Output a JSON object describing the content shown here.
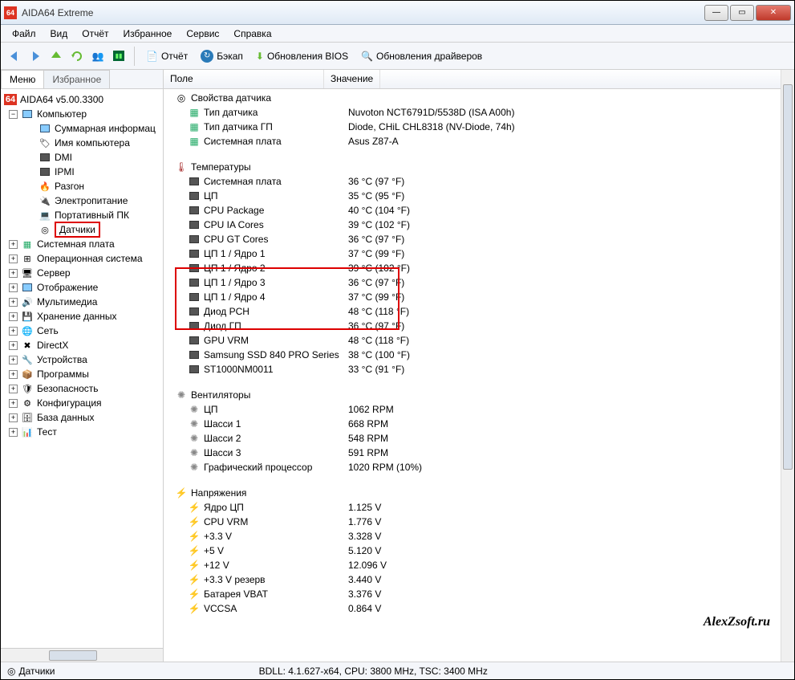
{
  "window": {
    "title": "AIDA64 Extreme"
  },
  "menu": [
    "Файл",
    "Вид",
    "Отчёт",
    "Избранное",
    "Сервис",
    "Справка"
  ],
  "toolbar": {
    "report": "Отчёт",
    "backup": "Бэкап",
    "bios_update": "Обновления BIOS",
    "driver_update": "Обновления драйверов"
  },
  "tabs": {
    "menu": "Меню",
    "fav": "Избранное"
  },
  "tree": {
    "root": "AIDA64 v5.00.3300",
    "computer": "Компьютер",
    "computer_children": [
      "Суммарная информац",
      "Имя компьютера",
      "DMI",
      "IPMI",
      "Разгон",
      "Электропитание",
      "Портативный ПК",
      "Датчики"
    ],
    "others": [
      "Системная плата",
      "Операционная система",
      "Сервер",
      "Отображение",
      "Мультимедиа",
      "Хранение данных",
      "Сеть",
      "DirectX",
      "Устройства",
      "Программы",
      "Безопасность",
      "Конфигурация",
      "База данных",
      "Тест"
    ]
  },
  "columns": {
    "field": "Поле",
    "value": "Значение"
  },
  "sections": {
    "props": {
      "title": "Свойства датчика",
      "rows": [
        {
          "f": "Тип датчика",
          "v": "Nuvoton NCT6791D/5538D  (ISA A00h)"
        },
        {
          "f": "Тип датчика ГП",
          "v": "Diode, CHiL CHL8318  (NV-Diode, 74h)"
        },
        {
          "f": "Системная плата",
          "v": "Asus Z87-A"
        }
      ]
    },
    "temps": {
      "title": "Температуры",
      "rows": [
        {
          "f": "Системная плата",
          "v": "36 °C  (97 °F)"
        },
        {
          "f": "ЦП",
          "v": "35 °C  (95 °F)"
        },
        {
          "f": "CPU Package",
          "v": "40 °C  (104 °F)"
        },
        {
          "f": "CPU IA Cores",
          "v": "39 °C  (102 °F)"
        },
        {
          "f": "CPU GT Cores",
          "v": "36 °C  (97 °F)"
        },
        {
          "f": "ЦП 1 / Ядро 1",
          "v": "37 °C  (99 °F)"
        },
        {
          "f": "ЦП 1 / Ядро 2",
          "v": "39 °C  (102 °F)"
        },
        {
          "f": "ЦП 1 / Ядро 3",
          "v": "36 °C  (97 °F)"
        },
        {
          "f": "ЦП 1 / Ядро 4",
          "v": "37 °C  (99 °F)"
        },
        {
          "f": "Диод PCH",
          "v": "48 °C  (118 °F)"
        },
        {
          "f": "Диод ГП",
          "v": "36 °C  (97 °F)"
        },
        {
          "f": "GPU VRM",
          "v": "48 °C  (118 °F)"
        },
        {
          "f": "Samsung SSD 840 PRO Series",
          "v": "38 °C  (100 °F)"
        },
        {
          "f": "ST1000NM0011",
          "v": "33 °C  (91 °F)"
        }
      ]
    },
    "fans": {
      "title": "Вентиляторы",
      "rows": [
        {
          "f": "ЦП",
          "v": "1062 RPM"
        },
        {
          "f": "Шасси 1",
          "v": "668 RPM"
        },
        {
          "f": "Шасси 2",
          "v": "548 RPM"
        },
        {
          "f": "Шасси 3",
          "v": "591 RPM"
        },
        {
          "f": "Графический процессор",
          "v": "1020 RPM  (10%)"
        }
      ]
    },
    "volts": {
      "title": "Напряжения",
      "rows": [
        {
          "f": "Ядро ЦП",
          "v": "1.125 V"
        },
        {
          "f": "CPU VRM",
          "v": "1.776 V"
        },
        {
          "f": "+3.3 V",
          "v": "3.328 V"
        },
        {
          "f": "+5 V",
          "v": "5.120 V"
        },
        {
          "f": "+12 V",
          "v": "12.096 V"
        },
        {
          "f": "+3.3 V резерв",
          "v": "3.440 V"
        },
        {
          "f": "Батарея VBAT",
          "v": "3.376 V"
        },
        {
          "f": "VCCSA",
          "v": "0.864 V"
        }
      ]
    }
  },
  "statusbar": {
    "left": "Датчики",
    "right": "BDLL: 4.1.627-x64, CPU: 3800 MHz, TSC: 3400 MHz"
  },
  "watermark": "AlexZsoft.ru"
}
